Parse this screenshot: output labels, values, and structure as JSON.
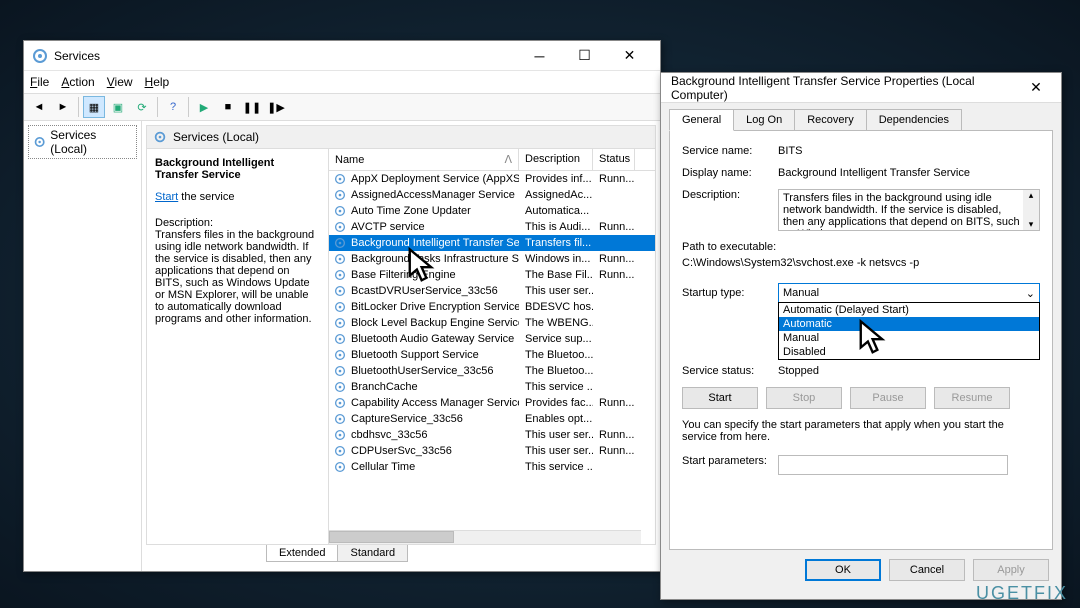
{
  "services_window": {
    "title": "Services",
    "menu": {
      "file": "File",
      "action": "Action",
      "view": "View",
      "help": "Help"
    },
    "tree_item": "Services (Local)",
    "pane_header": "Services (Local)",
    "detail": {
      "title": "Background Intelligent Transfer Service",
      "action_verb": "Start",
      "action_rest": " the service",
      "desc_label": "Description:",
      "desc_text": "Transfers files in the background using idle network bandwidth. If the service is disabled, then any applications that depend on BITS, such as Windows Update or MSN Explorer, will be unable to automatically download programs and other information."
    },
    "columns": {
      "name": "Name",
      "description": "Description",
      "status": "Status"
    },
    "rows": [
      {
        "name": "AppX Deployment Service (AppXSVC)",
        "desc": "Provides inf...",
        "status": "Runn..."
      },
      {
        "name": "AssignedAccessManager Service",
        "desc": "AssignedAc...",
        "status": ""
      },
      {
        "name": "Auto Time Zone Updater",
        "desc": "Automatica...",
        "status": ""
      },
      {
        "name": "AVCTP service",
        "desc": "This is Audi...",
        "status": "Runn..."
      },
      {
        "name": "Background Intelligent Transfer Service",
        "desc": "Transfers fil...",
        "status": "",
        "selected": true
      },
      {
        "name": "Background Tasks Infrastructure Service",
        "desc": "Windows in...",
        "status": "Runn..."
      },
      {
        "name": "Base Filtering Engine",
        "desc": "The Base Fil...",
        "status": "Runn..."
      },
      {
        "name": "BcastDVRUserService_33c56",
        "desc": "This user ser...",
        "status": ""
      },
      {
        "name": "BitLocker Drive Encryption Service",
        "desc": "BDESVC hos...",
        "status": ""
      },
      {
        "name": "Block Level Backup Engine Service",
        "desc": "The WBENG...",
        "status": ""
      },
      {
        "name": "Bluetooth Audio Gateway Service",
        "desc": "Service sup...",
        "status": ""
      },
      {
        "name": "Bluetooth Support Service",
        "desc": "The Bluetoo...",
        "status": ""
      },
      {
        "name": "BluetoothUserService_33c56",
        "desc": "The Bluetoo...",
        "status": ""
      },
      {
        "name": "BranchCache",
        "desc": "This service ...",
        "status": ""
      },
      {
        "name": "Capability Access Manager Service",
        "desc": "Provides fac...",
        "status": "Runn..."
      },
      {
        "name": "CaptureService_33c56",
        "desc": "Enables opt...",
        "status": ""
      },
      {
        "name": "cbdhsvc_33c56",
        "desc": "This user ser...",
        "status": "Runn..."
      },
      {
        "name": "CDPUserSvc_33c56",
        "desc": "This user ser...",
        "status": "Runn..."
      },
      {
        "name": "Cellular Time",
        "desc": "This service ...",
        "status": ""
      }
    ],
    "tabs": {
      "extended": "Extended",
      "standard": "Standard"
    }
  },
  "props_window": {
    "title": "Background Intelligent Transfer Service Properties (Local Computer)",
    "tabs": {
      "general": "General",
      "logon": "Log On",
      "recovery": "Recovery",
      "dependencies": "Dependencies"
    },
    "labels": {
      "service_name": "Service name:",
      "display_name": "Display name:",
      "description": "Description:",
      "path": "Path to executable:",
      "startup_type": "Startup type:",
      "service_status": "Service status:",
      "note": "You can specify the start parameters that apply when you start the service from here.",
      "start_params": "Start parameters:"
    },
    "values": {
      "service_name": "BITS",
      "display_name": "Background Intelligent Transfer Service",
      "description": "Transfers files in the background using idle network bandwidth. If the service is disabled, then any applications that depend on BITS, such as Windows",
      "path": "C:\\Windows\\System32\\svchost.exe -k netsvcs -p",
      "startup_selected": "Manual",
      "service_status": "Stopped"
    },
    "startup_options": [
      {
        "label": "Automatic (Delayed Start)"
      },
      {
        "label": "Automatic",
        "highlight": true
      },
      {
        "label": "Manual"
      },
      {
        "label": "Disabled"
      }
    ],
    "buttons": {
      "start": "Start",
      "stop": "Stop",
      "pause": "Pause",
      "resume": "Resume",
      "ok": "OK",
      "cancel": "Cancel",
      "apply": "Apply"
    }
  },
  "watermark": "UGETFIX"
}
